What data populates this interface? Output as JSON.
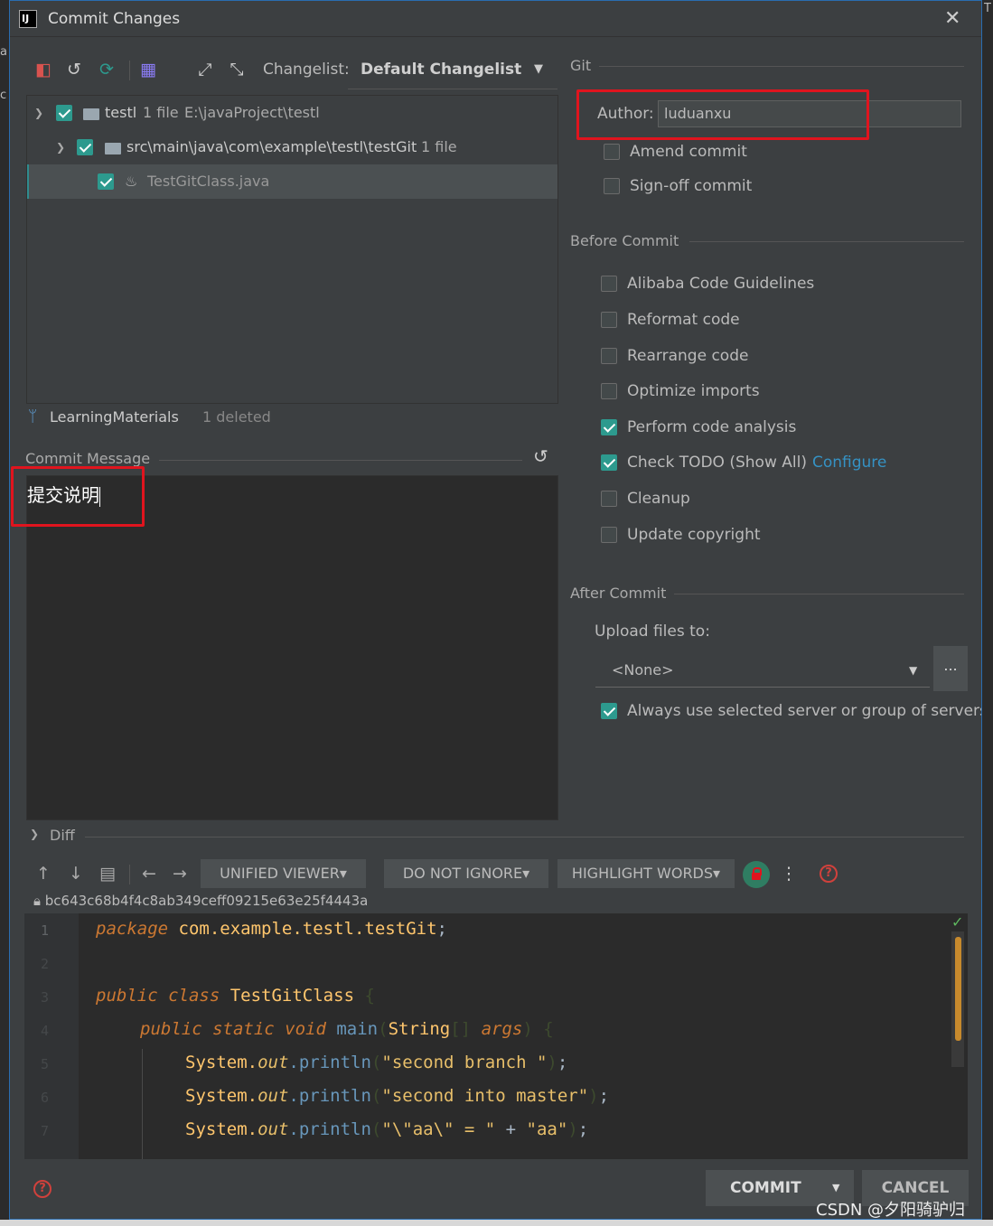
{
  "window": {
    "title": "Commit Changes",
    "close_glyph": "✕"
  },
  "toolbar": {
    "changelist_label": "Changelist:",
    "changelist_value": "Default Changelist"
  },
  "tree": {
    "root": {
      "name": "testl",
      "count": "1 file",
      "path": "E:\\javaProject\\testl"
    },
    "pkg": {
      "name": "src\\main\\java\\com\\example\\testl\\testGit",
      "count": "1 file"
    },
    "file": {
      "name": "TestGitClass.java"
    }
  },
  "branch": {
    "name": "LearningMaterials",
    "status": "1 deleted"
  },
  "commit_message": {
    "label": "Commit Message",
    "value": "提交说明"
  },
  "git": {
    "section": "Git",
    "author_label": "Author:",
    "author_value": "luduanxu",
    "amend_label": "Amend commit",
    "signoff_label": "Sign-off commit"
  },
  "before_commit": {
    "section": "Before Commit",
    "items": [
      {
        "label": "Alibaba Code Guidelines",
        "checked": false
      },
      {
        "label": "Reformat code",
        "checked": false
      },
      {
        "label": "Rearrange code",
        "checked": false
      },
      {
        "label": "Optimize imports",
        "checked": false
      },
      {
        "label": "Perform code analysis",
        "checked": true
      },
      {
        "label": "Check TODO (Show All)",
        "checked": true,
        "link": "Configure"
      },
      {
        "label": "Cleanup",
        "checked": false
      },
      {
        "label": "Update copyright",
        "checked": false
      }
    ]
  },
  "after_commit": {
    "section": "After Commit",
    "upload_label": "Upload files to:",
    "upload_value": "<None>",
    "dots_label": "...",
    "always_label": "Always use selected server or group of servers"
  },
  "diff": {
    "section": "Diff",
    "viewer_label": "UNIFIED VIEWER▾",
    "ignore_label": "DO NOT IGNORE▾",
    "highlight_label": "HIGHLIGHT WORDS▾",
    "help_glyph": "?",
    "hash": "bc643c68b4f4c8ab349ceff09215e63e25f4443a"
  },
  "code": {
    "line_numbers": [
      "1",
      "2",
      "3",
      "4",
      "5",
      "6",
      "7"
    ],
    "l1_kw": "package",
    "l1_pkg": "com.example.testl.testGit",
    "l1_end": ";",
    "l3_kw": "public class",
    "l3_cls": "TestGitClass",
    "l3_brace": "{",
    "l4_kw": "public static void",
    "l4_mth": "main",
    "l4_p1": "(",
    "l4_type": "String",
    "l4_br": "[]",
    "l4_arg": "args",
    "l4_p2": ")",
    "l4_brace": "{",
    "sys": "System.",
    "out": "out",
    "println": ".println",
    "paren_open": "(",
    "l5_str": "\"second branch \"",
    "l6_str": "\"second into master\"",
    "l7_s1": "\"\\\"aa\\\" = \"",
    "l7_plus": " + ",
    "l7_s2": "\"aa\"",
    "paren_close": ")",
    "semi": ";"
  },
  "buttons": {
    "commit": "COMMIT",
    "commit_arrow": "▼",
    "cancel": "CANCEL"
  },
  "watermark": "CSDN @夕阳骑驴归",
  "icons": [
    "rollback-icon",
    "history-icon",
    "refresh-icon",
    "group-icon",
    "expand-icon",
    "collapse-icon",
    "arrow-up-icon",
    "arrow-down-icon",
    "file-icon",
    "arrow-left-icon",
    "arrow-right-icon",
    "lock-icon",
    "more-icon",
    "help-icon"
  ],
  "colors": {
    "accent": "#2d9a8e",
    "link": "#3592c4",
    "highlight_box": "#e0141e",
    "background": "#3c3f41"
  }
}
